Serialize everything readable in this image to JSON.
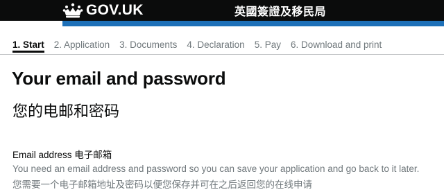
{
  "header": {
    "logo_text": "GOV.UK",
    "logo_icon": "crown-icon",
    "agency_name": "英國簽證及移民局",
    "colors": {
      "header_bg": "#0b0c0c",
      "accent_bar": "#1d70b8"
    }
  },
  "progress": {
    "steps": [
      {
        "label": "1. Start",
        "current": true
      },
      {
        "label": "2. Application",
        "current": false
      },
      {
        "label": "3. Documents",
        "current": false
      },
      {
        "label": "4. Declaration",
        "current": false
      },
      {
        "label": "5. Pay",
        "current": false
      },
      {
        "label": "6. Download and print",
        "current": false
      }
    ]
  },
  "main": {
    "title": "Your email and password",
    "title_zh": "您的电邮和密码",
    "email_label": "Email address 电子邮箱",
    "hint": "You need an email address and password so you can save your application and go back to it later.",
    "hint_zh": "您需要一个电子邮箱地址及密码以便您保存并可在之后返回您的在线申请"
  }
}
